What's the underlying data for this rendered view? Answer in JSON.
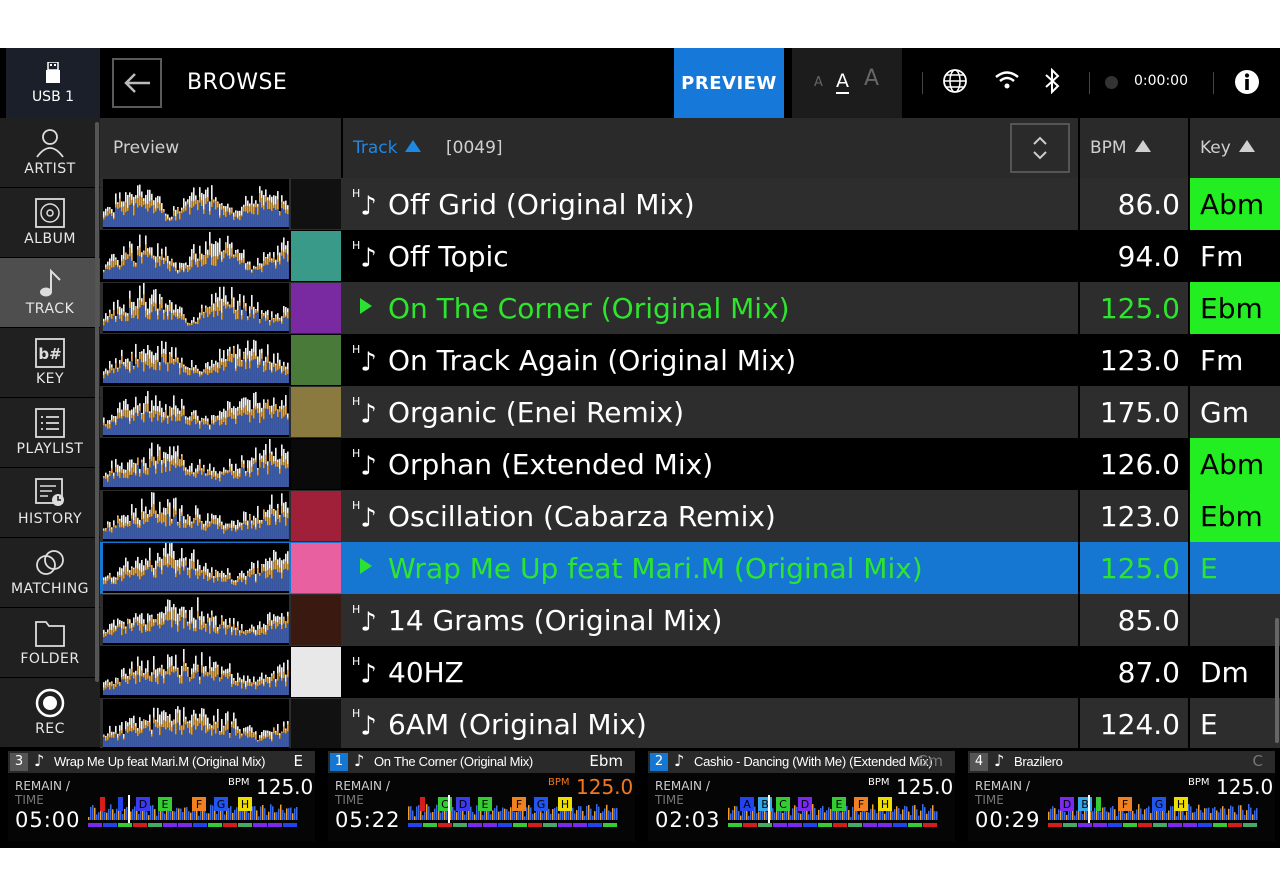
{
  "header": {
    "usb_label": "USB 1",
    "title": "BROWSE",
    "preview_label": "PREVIEW",
    "font_sizes": [
      "A",
      "A",
      "A"
    ],
    "rec_time": "0:00:00"
  },
  "sidebar": {
    "items": [
      {
        "label": "ARTIST",
        "icon": "person-icon"
      },
      {
        "label": "ALBUM",
        "icon": "disc-icon"
      },
      {
        "label": "TRACK",
        "icon": "note-icon"
      },
      {
        "label": "KEY",
        "icon": "key-icon"
      },
      {
        "label": "PLAYLIST",
        "icon": "playlist-icon"
      },
      {
        "label": "HISTORY",
        "icon": "history-icon"
      },
      {
        "label": "MATCHING",
        "icon": "matching-icon"
      },
      {
        "label": "FOLDER",
        "icon": "folder-icon"
      },
      {
        "label": "REC",
        "icon": "rec-icon"
      }
    ],
    "active_index": 2
  },
  "columns": {
    "preview": "Preview",
    "track": "Track",
    "count": "[0049]",
    "bpm": "BPM",
    "key": "Key"
  },
  "tracks": [
    {
      "title": "Off Grid (Original Mix)",
      "bpm": "86.0",
      "key": "Abm",
      "key_hl": true,
      "state": "normal",
      "art_color": "#111"
    },
    {
      "title": "Off Topic",
      "bpm": "94.0",
      "key": "Fm",
      "key_hl": false,
      "state": "normal",
      "art_color": "#3a9a8a"
    },
    {
      "title": "On The Corner (Original Mix)",
      "bpm": "125.0",
      "key": "Ebm",
      "key_hl": true,
      "state": "loaded",
      "art_color": "#7a2aa0"
    },
    {
      "title": "On Track Again (Original Mix)",
      "bpm": "123.0",
      "key": "Fm",
      "key_hl": false,
      "state": "normal",
      "art_color": "#4a7a3a"
    },
    {
      "title": "Organic (Enei Remix)",
      "bpm": "175.0",
      "key": "Gm",
      "key_hl": false,
      "state": "normal",
      "art_color": "#8a7a40"
    },
    {
      "title": "Orphan (Extended Mix)",
      "bpm": "126.0",
      "key": "Abm",
      "key_hl": true,
      "state": "normal",
      "art_color": "#0a0a0a"
    },
    {
      "title": "Oscillation (Cabarza Remix)",
      "bpm": "123.0",
      "key": "Ebm",
      "key_hl": true,
      "state": "normal",
      "art_color": "#a0203a"
    },
    {
      "title": "Wrap Me Up feat Mari.M (Original Mix)",
      "bpm": "125.0",
      "key": "E",
      "key_hl": false,
      "state": "selected",
      "art_color": "#e860a0"
    },
    {
      "title": "14 Grams (Original Mix)",
      "bpm": "85.0",
      "key": "",
      "key_hl": false,
      "state": "normal",
      "art_color": "#3a1a10"
    },
    {
      "title": "40HZ",
      "bpm": "87.0",
      "key": "Dm",
      "key_hl": false,
      "state": "normal",
      "art_color": "#e8e8e8"
    },
    {
      "title": "6AM (Original Mix)",
      "bpm": "124.0",
      "key": "E",
      "key_hl": false,
      "state": "normal",
      "art_color": "#111"
    }
  ],
  "decks": [
    {
      "num": "3",
      "title": "Wrap Me Up feat Mari.M (Original Mix)",
      "key": "E",
      "remain": "REMAIN /",
      "time_label": "TIME",
      "time": "05:00",
      "bpm_label": "BPM",
      "bpm": "125.0",
      "active": false,
      "cues": [
        {
          "l": "",
          "c": "#d81b1b"
        },
        {
          "l": "",
          "c": "#2244ee"
        },
        {
          "l": "D",
          "c": "#3a3aee"
        },
        {
          "l": "E",
          "c": "#33cc33"
        },
        {
          "l": "F",
          "c": "#f08020"
        },
        {
          "l": "G",
          "c": "#2255ee"
        },
        {
          "l": "H",
          "c": "#eedd00"
        }
      ]
    },
    {
      "num": "1",
      "title": "On The Corner (Original Mix)",
      "key": "Ebm",
      "remain": "REMAIN /",
      "time_label": "TIME",
      "time": "05:22",
      "bpm_label": "BPM",
      "bpm": "125.0",
      "active": true,
      "cues": [
        {
          "l": "",
          "c": "#d81b1b"
        },
        {
          "l": "C",
          "c": "#33cc33"
        },
        {
          "l": "D",
          "c": "#3a3aee"
        },
        {
          "l": "E",
          "c": "#33cc33"
        },
        {
          "l": "F",
          "c": "#f08020"
        },
        {
          "l": "G",
          "c": "#2255ee"
        },
        {
          "l": "H",
          "c": "#eedd00"
        }
      ]
    },
    {
      "num": "2",
      "title": "Cashio - Dancing (With Me) (Extended Mix)",
      "key": "Gm",
      "remain": "REMAIN /",
      "time_label": "TIME",
      "time": "02:03",
      "bpm_label": "BPM",
      "bpm": "125.0",
      "active": true,
      "cues": [
        {
          "l": "A",
          "c": "#2244ee"
        },
        {
          "l": "B",
          "c": "#33aaee"
        },
        {
          "l": "C",
          "c": "#33cc33"
        },
        {
          "l": "D",
          "c": "#7a2aee"
        },
        {
          "l": "E",
          "c": "#33cc33"
        },
        {
          "l": "F",
          "c": "#f08020"
        },
        {
          "l": "H",
          "c": "#eedd00"
        }
      ]
    },
    {
      "num": "4",
      "title": "Brazilero",
      "key": "C",
      "remain": "REMAIN /",
      "time_label": "TIME",
      "time": "00:29",
      "bpm_label": "BPM",
      "bpm": "125.0",
      "active": false,
      "cues": [
        {
          "l": "D",
          "c": "#7a2aee"
        },
        {
          "l": "B",
          "c": "#33aaee"
        },
        {
          "l": "",
          "c": "#33cc33"
        },
        {
          "l": "F",
          "c": "#f08020"
        },
        {
          "l": "G",
          "c": "#2255ee"
        },
        {
          "l": "H",
          "c": "#eedd00"
        }
      ]
    }
  ]
}
